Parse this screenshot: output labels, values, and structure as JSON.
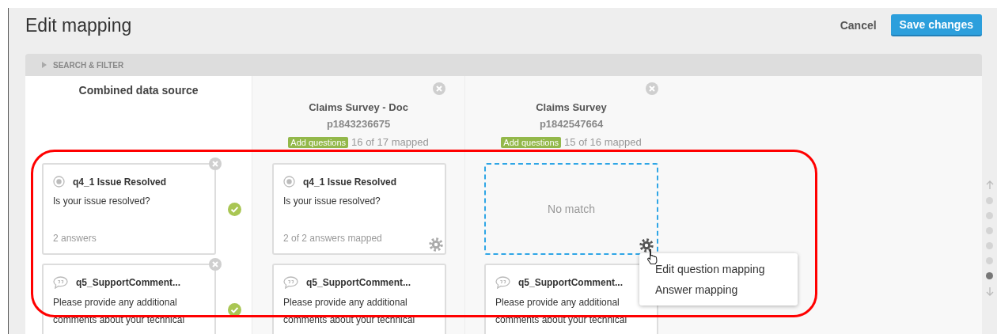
{
  "header": {
    "title": "Edit mapping",
    "cancel": "Cancel",
    "save": "Save changes"
  },
  "search_filter": {
    "label": "SEARCH & FILTER",
    "expanded": false
  },
  "combined": {
    "title": "Combined data source",
    "cards": [
      {
        "kind": "choice",
        "title": "q4_1 Issue Resolved",
        "text": "Is your issue resolved?",
        "footer": "2 answers",
        "matched": true
      },
      {
        "kind": "text",
        "title": "q5_SupportComment...",
        "text": "Please provide any additional comments about your technical",
        "matched": true
      }
    ]
  },
  "sources": [
    {
      "title": "Claims Survey - Doc",
      "id": "p1843236675",
      "add_label": "Add questions",
      "mapped": "16 of 17 mapped",
      "cards": [
        {
          "kind": "choice",
          "title": "q4_1 Issue Resolved",
          "text": "Is your issue resolved?",
          "footer": "2 of 2 answers mapped",
          "gear": true
        },
        {
          "kind": "text",
          "title": "q5_SupportComment...",
          "text": "Please provide any additional comments about your technical",
          "gear": false
        }
      ]
    },
    {
      "title": "Claims Survey",
      "id": "p1842547664",
      "add_label": "Add questions",
      "mapped": "15 of 16 mapped",
      "cards": [
        {
          "kind": "empty",
          "label": "No match",
          "gear": true,
          "cursor": true
        },
        {
          "kind": "text",
          "title": "q5_SupportComment...",
          "text": "Please provide any additional comments about your technical",
          "gear": false
        }
      ]
    }
  ],
  "context_menu": {
    "items": [
      "Edit question mapping",
      "Answer mapping"
    ]
  },
  "nav_dots": [
    {
      "selected": false
    },
    {
      "selected": false
    },
    {
      "selected": false
    },
    {
      "selected": false
    },
    {
      "selected": false
    },
    {
      "selected": true
    }
  ]
}
